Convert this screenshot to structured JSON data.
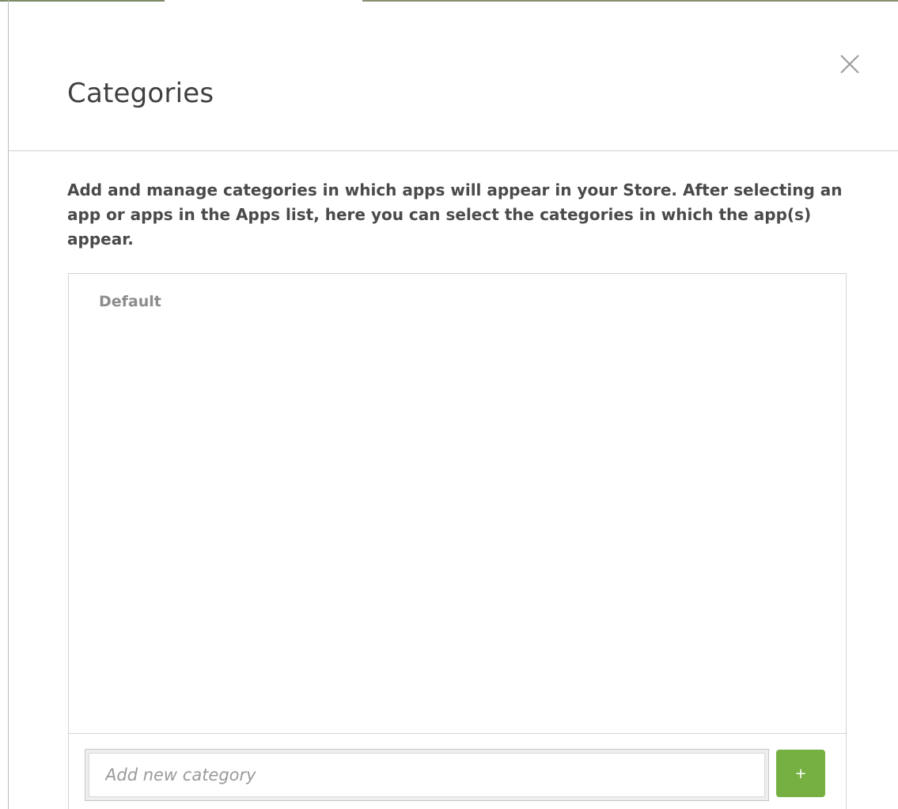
{
  "dialog": {
    "title": "Categories",
    "close_icon": "close-icon",
    "description": "Add and manage categories in which apps will appear in your Store. After selecting an app or apps in the Apps list, here you can select the categories in which the app(s) appear."
  },
  "categories": {
    "items": [
      {
        "label": "Default"
      }
    ],
    "new_category": {
      "value": "",
      "placeholder": "Add new category"
    },
    "add_button_label": "+"
  },
  "colors": {
    "add_button": "#76b043",
    "title_text": "#404040",
    "category_text": "#8c8c8c"
  }
}
